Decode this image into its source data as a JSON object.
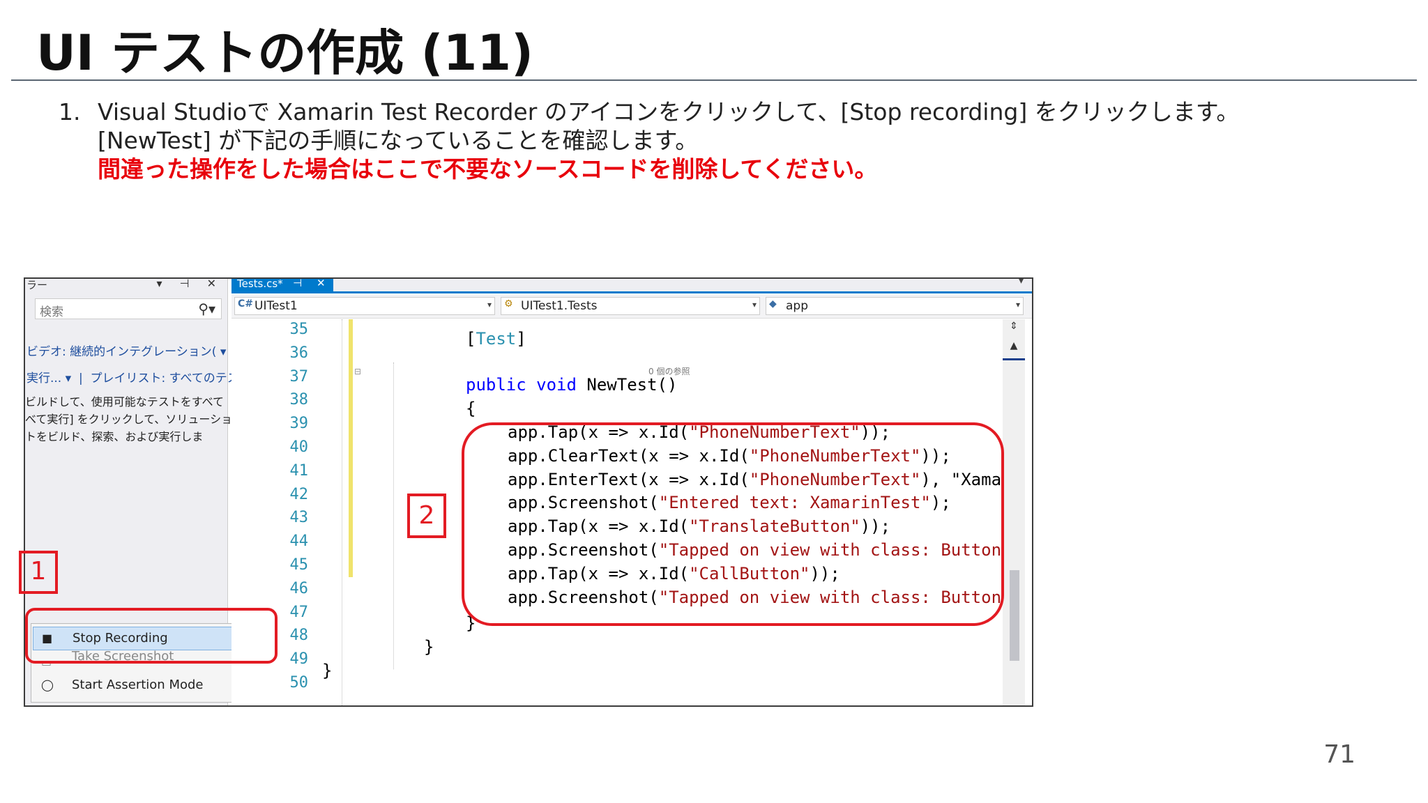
{
  "slide": {
    "title": "UI テストの作成 (11)",
    "step_number": "1.",
    "step_line1": "Visual Studioで Xamarin Test Recorder のアイコンをクリックして、[Stop recording] をクリックします。",
    "step_line2": "[NewTest] が下記の手順になっていることを確認します。",
    "step_warning": "間違った操作をした場合はここで不要なソースコードを削除してください。",
    "page_number": "71",
    "warning_color": "#e8000b"
  },
  "left_panel": {
    "title_fragment": "ラー",
    "search_placeholder": "検索",
    "video_link": "ビデオ: 継続的インテグレーション(",
    "run_link": "実行...",
    "playlist_link": "プレイリスト: すべてのテス",
    "desc_line1": "ビルドして、使用可能なテストをすべて",
    "desc_line2": "べて実行] をクリックして、ソリューショ",
    "desc_line3": "トをビルド、探索、および実行しま"
  },
  "context_menu": {
    "items": [
      {
        "label": "Stop Recording",
        "icon": "stop-square-icon",
        "selected": true
      },
      {
        "label": "Take Screenshot",
        "icon": "camera-icon",
        "selected": false
      },
      {
        "label": "Start Assertion Mode",
        "icon": "circle-icon",
        "selected": false
      }
    ]
  },
  "editor": {
    "tab_name": "Tests.cs*",
    "pin_glyph": "⊣",
    "close_glyph": "✕",
    "nav_project": "UITest1",
    "nav_class": "UITest1.Tests",
    "nav_member": "app",
    "ref_count": "0 個の参照",
    "line_numbers": [
      "35",
      "36",
      "37",
      "38",
      "39",
      "40",
      "41",
      "42",
      "43",
      "44",
      "45",
      "46",
      "47",
      "48",
      "49",
      "50"
    ],
    "attr_open": "[",
    "attr_name": "Test",
    "attr_close": "]",
    "kw_public": "public",
    "kw_void": "void",
    "method_sig": " NewTest()",
    "brace_open": "{",
    "brace_close": "}",
    "code_lines": [
      {
        "pre": "app.Tap(x => x.Id(",
        "str": "\"PhoneNumberText\"",
        "post": "));"
      },
      {
        "pre": "app.ClearText(x => x.Id(",
        "str": "\"PhoneNumberText\"",
        "post": "));"
      },
      {
        "pre": "app.EnterText(x => x.Id(",
        "str": "\"PhoneNumberText\"",
        "post": "), \"Xamar"
      },
      {
        "pre": "app.Screenshot(",
        "str": "\"Entered text: XamarinTest\"",
        "post": ");"
      },
      {
        "pre": "app.Tap(x => x.Id(",
        "str": "\"TranslateButton\"",
        "post": "));"
      },
      {
        "pre": "app.Screenshot(",
        "str": "\"Tapped on view with class: Button",
        "post": ""
      },
      {
        "pre": "app.Tap(x => x.Id(",
        "str": "\"CallButton\"",
        "post": "));"
      },
      {
        "pre": "app.Screenshot(",
        "str": "\"Tapped on view with class: Button",
        "post": ""
      }
    ]
  },
  "callouts": {
    "one": "1",
    "two": "2",
    "color": "#e31b23"
  }
}
